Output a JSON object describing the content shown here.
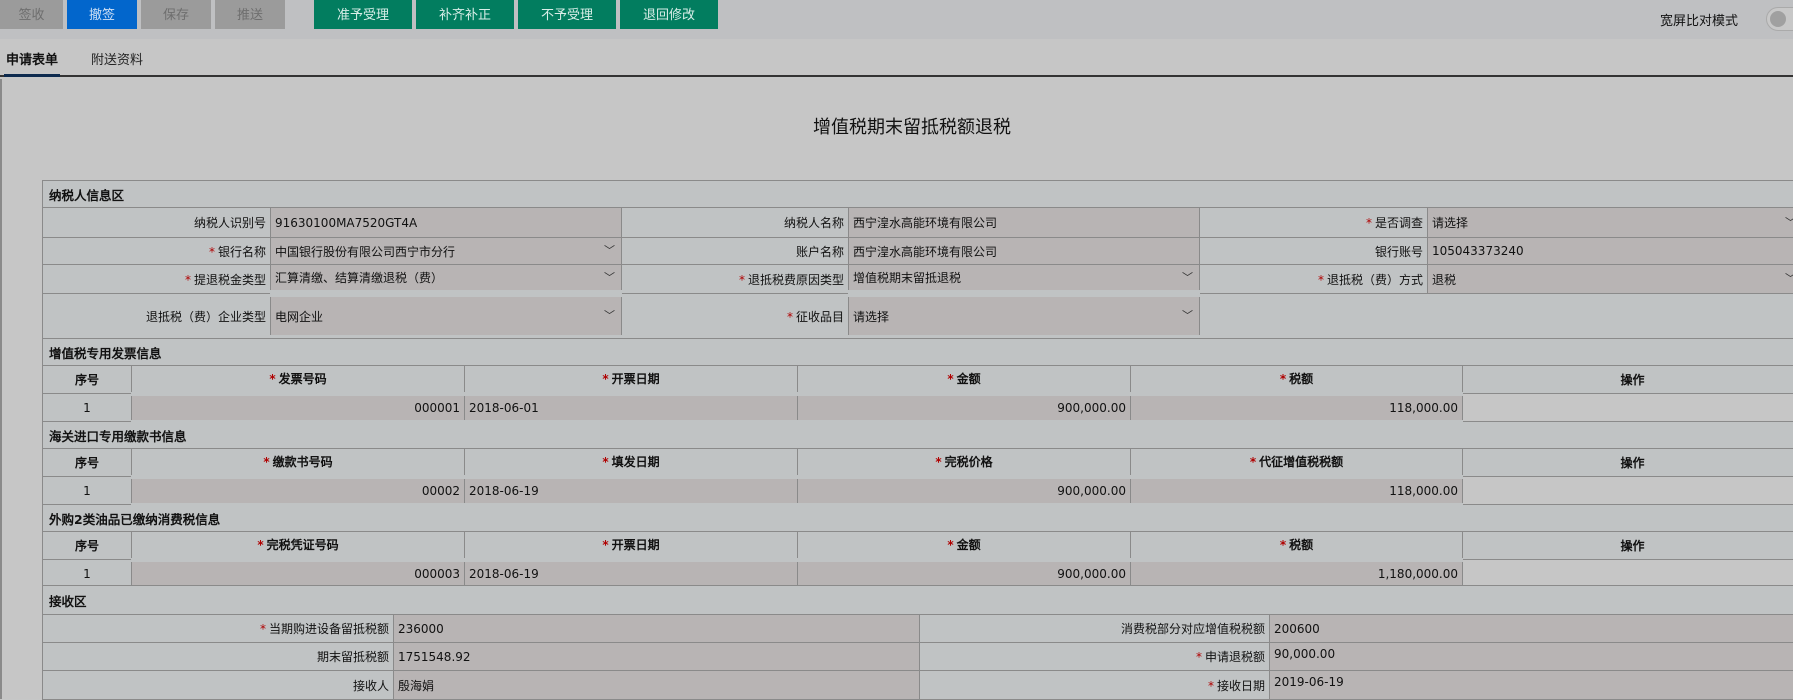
{
  "toolbar": {
    "sign": "签收",
    "unsign": "撤签",
    "save": "保存",
    "push": "推送",
    "accept": "准予受理",
    "supplement": "补齐补正",
    "reject": "不予受理",
    "return": "退回修改",
    "wide_mode": "宽屏比对模式"
  },
  "colors": {
    "blue": "#0266cc",
    "green": "#027d5f"
  },
  "tabs": [
    "申请表单",
    "附送资料"
  ],
  "title": "增值税期末留抵税额退税",
  "taxpayer": {
    "section": "纳税人信息区",
    "fields": [
      {
        "label": "纳税人识别号",
        "value": "91630100MA7520GT4A"
      },
      {
        "label": "纳税人名称",
        "value": "西宁湟水高能环境有限公司"
      },
      {
        "label": "是否调查",
        "value": "请选择"
      },
      {
        "label": "银行名称",
        "value": "中国银行股份有限公司西宁市分行"
      },
      {
        "label": "账户名称",
        "value": "西宁湟水高能环境有限公司"
      },
      {
        "label": "银行账号",
        "value": "105043373240"
      },
      {
        "label": "提退税金类型",
        "value": "汇算清缴、结算清缴退税（费）"
      },
      {
        "label": "退抵税费原因类型",
        "value": "增值税期末留抵退税"
      },
      {
        "label": "退抵税（费）方式",
        "value": "退税"
      },
      {
        "label": "退抵税（费）企业类型",
        "value": "电网企业"
      },
      {
        "label": "征收品目",
        "value": "请选择"
      }
    ]
  },
  "star": "*",
  "tables": [
    {
      "section": "增值税专用发票信息",
      "headers": [
        "序号",
        "发票号码",
        "开票日期",
        "金额",
        "税额",
        "操作"
      ],
      "row": [
        "1",
        "000001",
        "2018-06-01",
        "900,000.00",
        "118,000.00"
      ]
    },
    {
      "section": "海关进口专用缴款书信息",
      "headers": [
        "序号",
        "缴款书号码",
        "填发日期",
        "完税价格",
        "代征增值税税额",
        "操作"
      ],
      "row": [
        "1",
        "00002",
        "2018-06-19",
        "900,000.00",
        "118,000.00"
      ]
    },
    {
      "section": "外购2类油品已缴纳消费税信息",
      "headers": [
        "序号",
        "完税凭证号码",
        "开票日期",
        "金额",
        "税额",
        "操作"
      ],
      "row": [
        "1",
        "000003",
        "2018-06-19",
        "900,000.00",
        "1,180,000.00"
      ]
    }
  ],
  "receive": {
    "section": "接收区",
    "fields": [
      {
        "label": "当期购进设备留抵税额",
        "value": "236000"
      },
      {
        "label": "消费税部分对应增值税税额",
        "value": "200600"
      },
      {
        "label": "期末留抵税额",
        "value": "1751548.92"
      },
      {
        "label": "申请退税额",
        "value": "90,000.00"
      },
      {
        "label": "接收人",
        "value": "殷海娟"
      },
      {
        "label": "接收日期",
        "value": "2019-06-19"
      }
    ]
  }
}
